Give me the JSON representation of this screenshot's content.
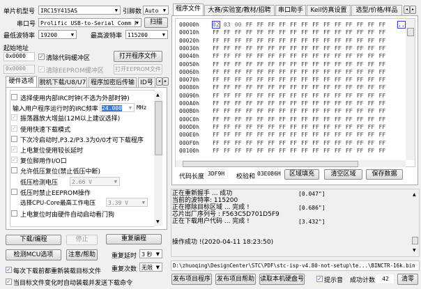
{
  "left": {
    "mcu_label": "单片机型号",
    "mcu_value": "IRC15Y415AS",
    "pins_label": "引脚数",
    "pins_value": "Auto",
    "port_label": "串口号",
    "port_value": "Prolific USB-to-Serial Comm P",
    "scan_label": "扫描",
    "min_baud_label": "最低波特率",
    "min_baud_value": "19200",
    "max_baud_label": "最高波特率",
    "max_baud_value": "115200",
    "start_addr_label": "起始地址",
    "code_addr": "0x0000",
    "clear_code_label": "清除代码缓冲区",
    "open_program_label": "打开程序文件",
    "eeprom_addr": "0x0000",
    "clear_eeprom_label": "清除EEPROM缓冲区",
    "open_eeprom_label": "打开EEPROM文件",
    "tabs": [
      "硬件选项",
      "脱机下载/U8/U7",
      "程序加密后传输",
      "ID号"
    ],
    "options": [
      {
        "label": "选择使用内部IRC时钟(不选为外部时钟)",
        "checked": false
      },
      {
        "label": "振荡器放大增益(12M以上建议选择)",
        "checked": true
      },
      {
        "label": "使用快速下载模式",
        "checked": true
      },
      {
        "label": "下次冷启动时,P3.2/P3.3为0/0才可下载程序",
        "checked": false
      },
      {
        "label": "上电复位使用较长延时",
        "checked": true
      },
      {
        "label": "复位脚用作I/O口",
        "checked": true
      },
      {
        "label": "允许低压复位(禁止低压中断)",
        "checked": false
      },
      {
        "label": "低压时禁止EEPROM操作",
        "checked": false
      },
      {
        "label": "上电复位时由硬件自动启动看门狗",
        "checked": false
      }
    ],
    "irc_freq_label": "输入用户程序运行时的IRC频率",
    "irc_freq_value": "24.000",
    "irc_unit": "MHz",
    "lv_label": "低压检测电压",
    "lv_value": "2.66 V",
    "core_label": "选择CPU-Core最高工作电压",
    "core_value": "3.39 V",
    "download_label": "下载/编程",
    "stop_label": "停止",
    "repeat_label": "重复编程",
    "check_mcu_label": "检测MCU选项",
    "help_label": "注意/帮助",
    "repeat_delay_label": "重复延时",
    "repeat_delay_value": "3 秒",
    "repeat_count_label": "重复次数",
    "repeat_count_value": "无限",
    "reload_label": "每次下载前都重新装载目标文件",
    "auto_label": "当目标文件变化时自动装载并发送下载命令"
  },
  "right": {
    "tabs": [
      "程序文件",
      "大赛/实验室/教材/招聘",
      "串口助手",
      "Keil仿真设置",
      "选型/价格/样品"
    ],
    "hex_rows": [
      "00000h",
      "00010h",
      "00020h",
      "00030h",
      "00040h",
      "00050h",
      "00060h",
      "00070h",
      "00080h",
      "00090h",
      "000A0h",
      "000B0h",
      "000C0h",
      "000D0h",
      "000E0h",
      "000F0h",
      "00100h"
    ],
    "first_row_bytes": [
      "02",
      "03",
      "00"
    ],
    "fill_byte": "FF",
    "ascii_first": "..",
    "code_len_label": "代码长度",
    "code_len_value": "3DF9H",
    "checksum_label": "校验和",
    "checksum_value": "03E086H",
    "fill_label": "区域填充",
    "clear_area_label": "清空区域",
    "save_label": "保存数据",
    "log": [
      {
        "text": "正在重新握手 ... 成功",
        "time": "[0.047\"]"
      },
      {
        "text": "当前的波特率: 115200",
        "time": ""
      },
      {
        "text": "正在擦除目标区域 ... 完成 !",
        "time": "[0.686\"]"
      },
      {
        "text": "芯片出厂序列号 : F563C5D701D5F9",
        "time": ""
      },
      {
        "text": "正在下载用户代码 ... 完成 !",
        "time": "[3.432\"]"
      }
    ],
    "log_result": "操作成功 !(2020-04-11 18:23:50)",
    "path": "D:\\zhuoqing\\DesignCenter\\STC\\PDF\\stc-isp-v4.80-not-setup\\te...\\BINCTR-16k.bin",
    "publish_program_label": "发布项目程序",
    "publish_help_label": "发布项目帮助",
    "read_disk_label": "读取本机硬盘号",
    "sound_label": "提示音",
    "success_count_label": "成功计数",
    "success_count_value": "42",
    "clear_count_label": "清零"
  }
}
